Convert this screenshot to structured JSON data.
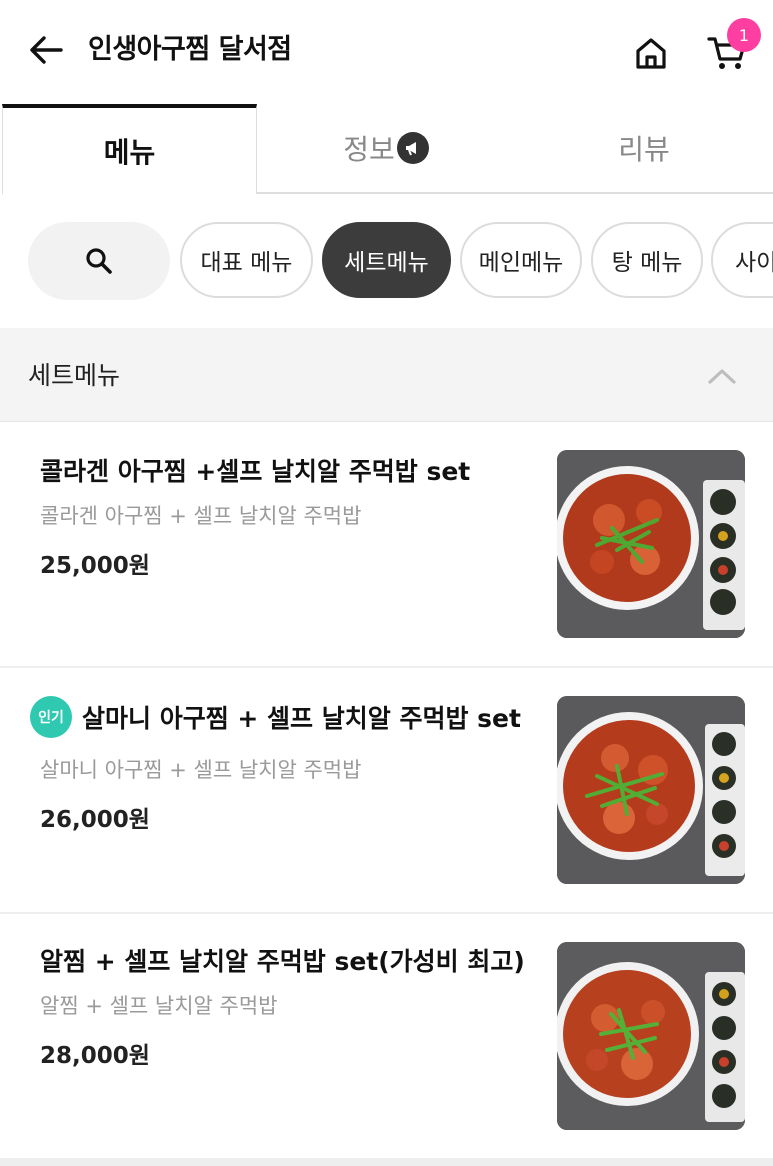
{
  "header": {
    "title": "인생아구찜 달서점",
    "cart_count": "1",
    "back_icon": "arrow-left-icon",
    "home_icon": "home-icon",
    "cart_icon": "cart-icon"
  },
  "tabs": [
    {
      "label": "메뉴",
      "active": true
    },
    {
      "label": "정보",
      "active": false,
      "icon": "megaphone-icon"
    },
    {
      "label": "리뷰",
      "active": false
    }
  ],
  "categories": {
    "search_icon": "search-icon",
    "chips": [
      {
        "label": "대표 메뉴",
        "active": false
      },
      {
        "label": "세트메뉴",
        "active": true
      },
      {
        "label": "메인메뉴",
        "active": false
      },
      {
        "label": "탕 메뉴",
        "active": false
      },
      {
        "label": "사이",
        "active": false
      }
    ]
  },
  "section": {
    "title": "세트메뉴",
    "collapse_icon": "chevron-up-icon"
  },
  "items": [
    {
      "name": "콜라겐 아구찜 +셀프 날치알 주먹밥 set",
      "desc": "콜라겐 아구찜 + 셀프 날치알 주먹밥",
      "price": "25,000원",
      "badge": ""
    },
    {
      "name": "살마니 아구찜 + 셀프 날치알 주먹밥 set",
      "desc": "살마니 아구찜 + 셀프 날치알 주먹밥",
      "price": "26,000원",
      "badge": "인기"
    },
    {
      "name": "알찜 + 셀프 날치알 주먹밥 set(가성비 최고)",
      "desc": "알찜 + 셀프 날치알 주먹밥",
      "price": "28,000원",
      "badge": ""
    }
  ],
  "colors": {
    "accent_badge": "#ff3ea2",
    "popular_badge": "#2ec9b0",
    "active_chip": "#3c3c3c"
  }
}
